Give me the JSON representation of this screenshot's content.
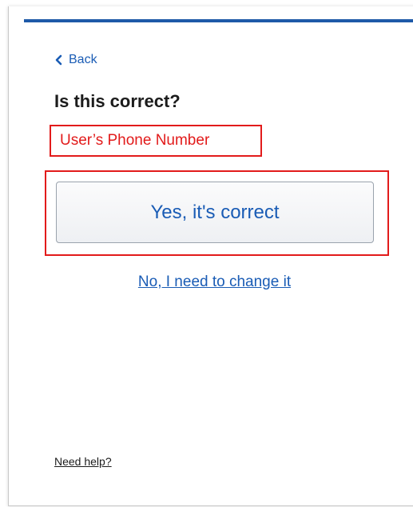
{
  "nav": {
    "back_label": "Back"
  },
  "main": {
    "title": "Is this correct?",
    "phone_number_label": "User’s Phone Number",
    "confirm_button_label": "Yes, it's correct",
    "change_link_label": "No, I need to change it"
  },
  "footer": {
    "help_label": "Need help?"
  },
  "icons": {
    "back": "chevron-left-icon"
  },
  "colors": {
    "accent_bar": "#1e5aa8",
    "link": "#1a5cb5",
    "highlight": "#e21b1b",
    "text": "#1c1c1c"
  }
}
